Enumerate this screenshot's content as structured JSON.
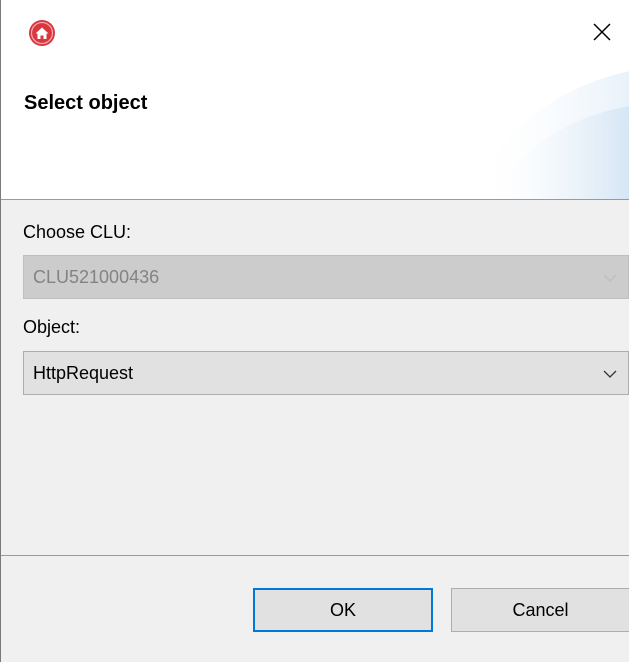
{
  "window": {
    "app_icon": "home-icon",
    "close_icon": "close-icon",
    "accent_color": "#d9363e"
  },
  "header": {
    "title": "Select object"
  },
  "form": {
    "clu_label": "Choose CLU:",
    "clu_value": "CLU521000436",
    "clu_disabled": true,
    "object_label": "Object:",
    "object_value": "HttpRequest"
  },
  "footer": {
    "ok_label": "OK",
    "cancel_label": "Cancel"
  }
}
